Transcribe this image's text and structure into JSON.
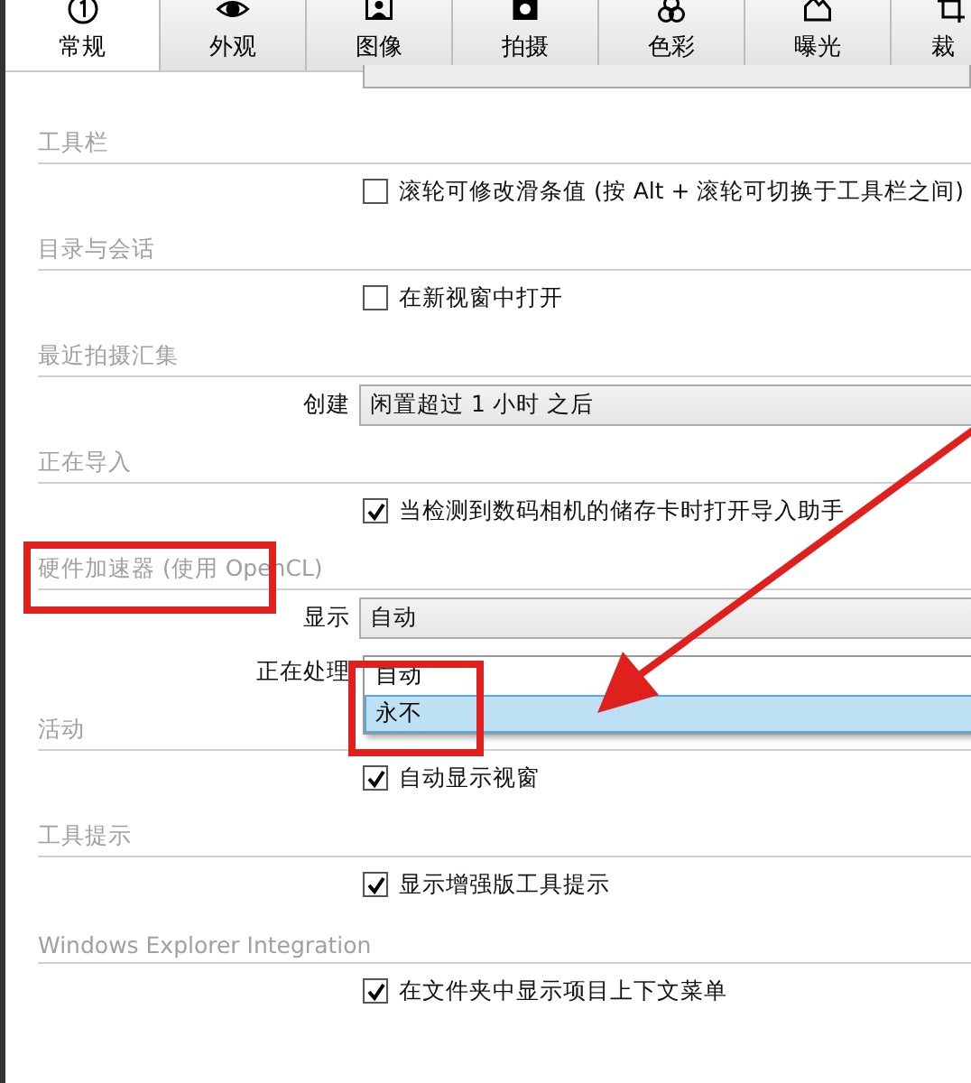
{
  "tabs": [
    {
      "label": "常规",
      "selected": true
    },
    {
      "label": "外观",
      "selected": false
    },
    {
      "label": "图像",
      "selected": false
    },
    {
      "label": "拍摄",
      "selected": false
    },
    {
      "label": "色彩",
      "selected": false
    },
    {
      "label": "曝光",
      "selected": false
    },
    {
      "label": "裁",
      "selected": false
    }
  ],
  "sections": [
    {
      "title": "工具栏",
      "rows": [
        {
          "kind": "checkbox",
          "label": "滚轮可修改滑条值 (按 Alt + 滚轮可切换于工具栏之间)",
          "checked": false
        }
      ]
    },
    {
      "title": "目录与会话",
      "rows": [
        {
          "kind": "checkbox",
          "label": "在新视窗中打开",
          "checked": false
        }
      ]
    },
    {
      "title": "最近拍摄汇集",
      "rows": [
        {
          "kind": "dropdown",
          "label": "创建",
          "value": "闲置超过 1 小时 之后"
        }
      ]
    },
    {
      "title": "正在导入",
      "rows": [
        {
          "kind": "checkbox",
          "label": "当检测到数码相机的储存卡时打开导入助手",
          "checked": true
        }
      ]
    },
    {
      "title": "硬件加速器 (使用 OpenCL)",
      "rows": [
        {
          "kind": "dropdown",
          "label": "显示",
          "value": "自动"
        },
        {
          "kind": "label",
          "label": "正在处理"
        }
      ]
    },
    {
      "title": "活动",
      "rows": [
        {
          "kind": "checkbox",
          "label": "自动显示视窗",
          "checked": true
        }
      ]
    },
    {
      "title": "工具提示",
      "rows": [
        {
          "kind": "checkbox",
          "label": "显示增强版工具提示",
          "checked": true
        }
      ]
    },
    {
      "title": "Windows Explorer Integration",
      "rows": [
        {
          "kind": "checkbox",
          "label": "在文件夹中显示项目上下文菜单",
          "checked": true
        }
      ]
    }
  ],
  "popup": {
    "options": [
      {
        "label": "自动",
        "selected": false
      },
      {
        "label": "永不",
        "selected": true
      }
    ]
  }
}
